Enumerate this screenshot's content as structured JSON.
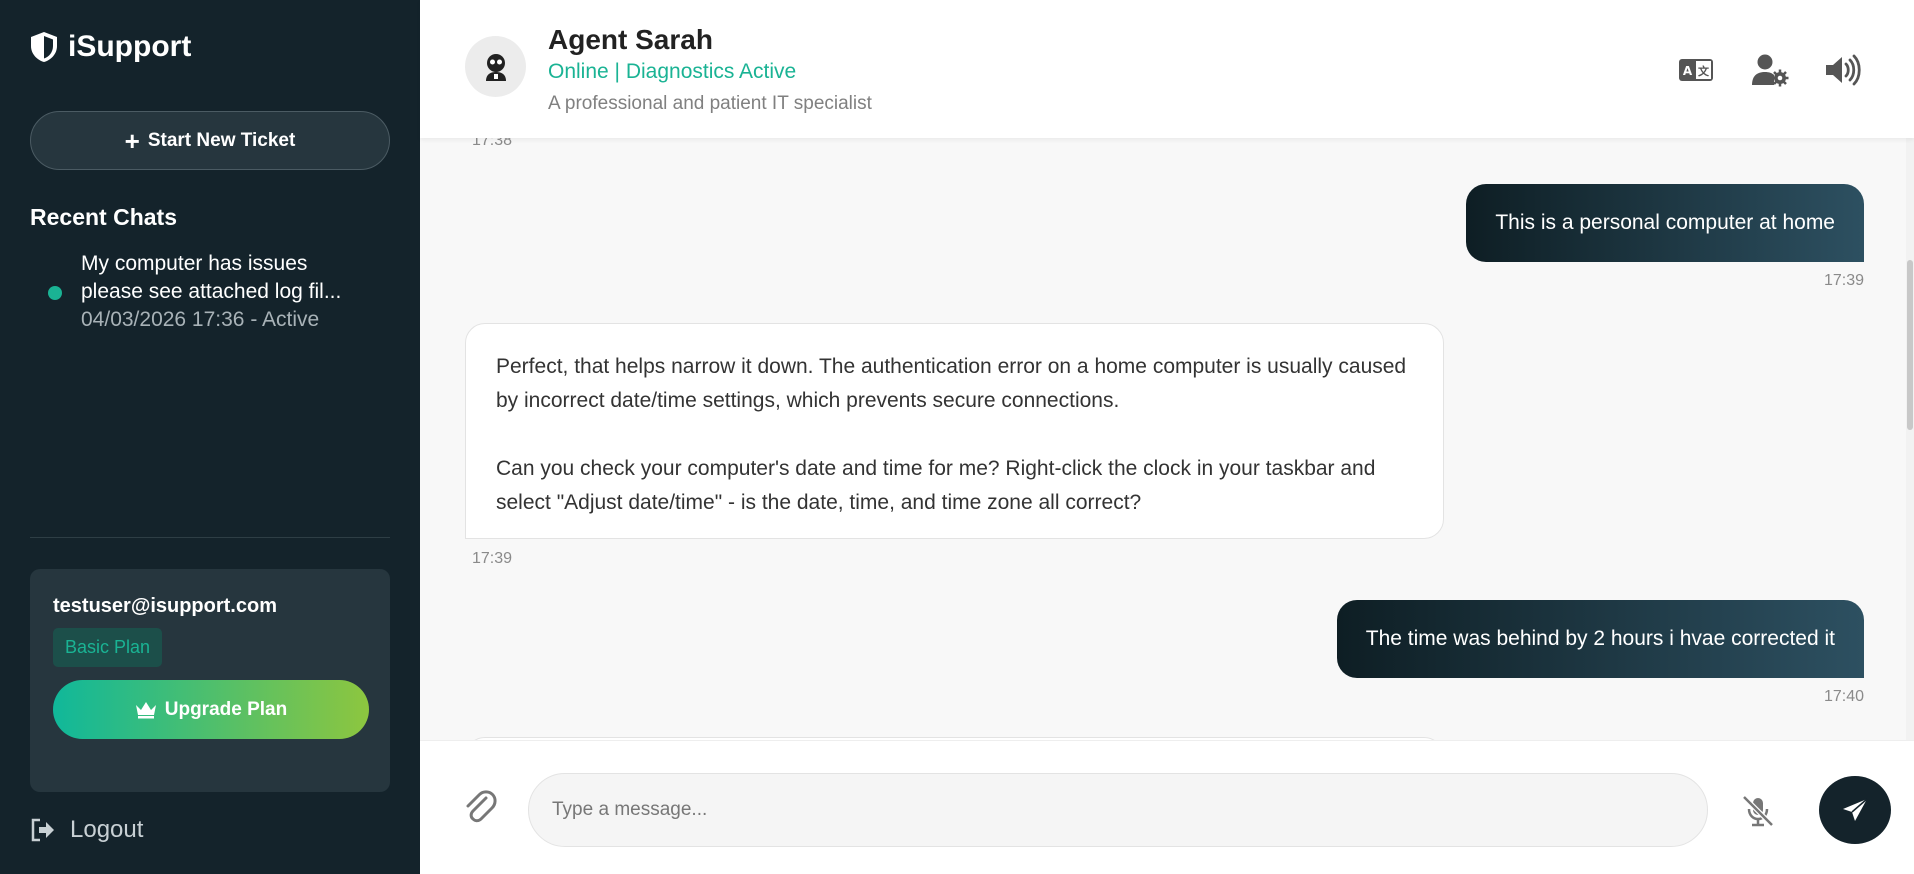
{
  "sidebar": {
    "brand": "iSupport",
    "new_ticket_label": "Start New Ticket",
    "recent_title": "Recent Chats",
    "recent_chats": [
      {
        "line1": "My computer has issues",
        "line2": "please see attached log fil...",
        "meta": "04/03/2026 17:36 - Active",
        "status": "active"
      }
    ],
    "user": {
      "email": "testuser@isupport.com",
      "plan": "Basic Plan",
      "upgrade_label": "Upgrade Plan"
    },
    "logout_label": "Logout"
  },
  "header": {
    "agent_name": "Agent Sarah",
    "status": "Online | Diagnostics Active",
    "description": "A professional and patient IT specialist",
    "icons": [
      "translate-icon",
      "user-settings-icon",
      "volume-icon"
    ]
  },
  "messages": [
    {
      "sender": "agent",
      "partial": true,
      "time": "17:38"
    },
    {
      "sender": "user",
      "text": "This is a personal computer at home",
      "time": "17:39"
    },
    {
      "sender": "agent",
      "paragraphs": [
        "Perfect, that helps narrow it down. The authentication error on a home computer is usually caused by incorrect date/time settings, which prevents secure connections.",
        "Can you check your computer's date and time for me? Right-click the clock in your taskbar and select \"Adjust date/time\" - is the date, time, and time zone all correct?"
      ],
      "time": "17:39"
    },
    {
      "sender": "user",
      "text": "The time was behind by 2 hours i hvae corrected it",
      "time": "17:40"
    }
  ],
  "composer": {
    "placeholder": "Type a message...",
    "value": ""
  },
  "colors": {
    "sidebar_bg": "#14232b",
    "accent": "#1ab394",
    "upgrade_gradient_start": "#10b89a",
    "upgrade_gradient_end": "#8dc63f"
  }
}
